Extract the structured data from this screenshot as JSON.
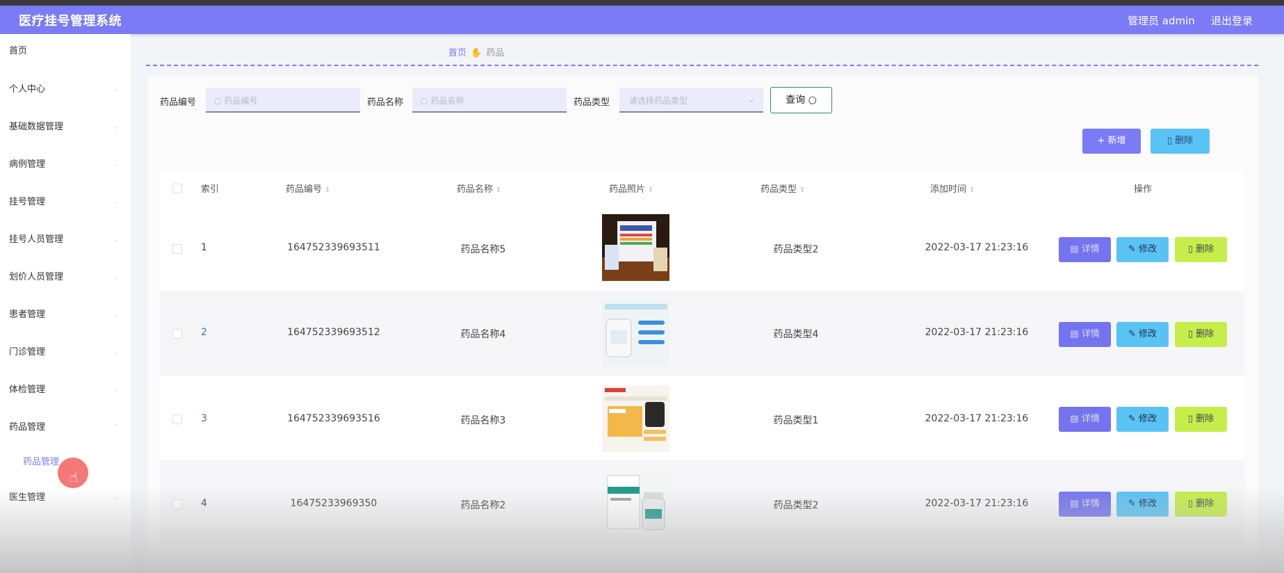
{
  "header": {
    "title": "医疗挂号管理系统",
    "user": "管理员 admin",
    "logout": "退出登录"
  },
  "sidebar": {
    "items": [
      {
        "label": "首页"
      },
      {
        "label": "个人中心"
      },
      {
        "label": "基础数据管理"
      },
      {
        "label": "病例管理"
      },
      {
        "label": "挂号管理"
      },
      {
        "label": "挂号人员管理"
      },
      {
        "label": "划价人员管理"
      },
      {
        "label": "患者管理"
      },
      {
        "label": "门诊管理"
      },
      {
        "label": "体检管理"
      },
      {
        "label": "药品管理"
      },
      {
        "label": "医生管理"
      }
    ],
    "active_sub": "药品管理"
  },
  "breadcrumb": {
    "home": "首页",
    "current": "药品"
  },
  "filters": {
    "code_label": "药品编号",
    "code_placeholder": "药品编号",
    "name_label": "药品名称",
    "name_placeholder": "药品名称",
    "type_label": "药品类型",
    "type_placeholder": "请选择药品类型",
    "search_label": "查询"
  },
  "actions": {
    "add_label": "+ 新增",
    "delete_label": "删除"
  },
  "table": {
    "columns": [
      "索引",
      "药品编号",
      "药品名称",
      "药品照片",
      "药品类型",
      "添加时间",
      "操作"
    ],
    "rows": [
      {
        "index": "1",
        "code": "164752339693511",
        "name": "药品名称5",
        "type": "药品类型2",
        "time": "2022-03-17 21:23:16"
      },
      {
        "index": "2",
        "code": "164752339693512",
        "name": "药品名称4",
        "type": "药品类型4",
        "time": "2022-03-17 21:23:16"
      },
      {
        "index": "3",
        "code": "164752339693516",
        "name": "药品名称3",
        "type": "药品类型1",
        "time": "2022-03-17 21:23:16"
      },
      {
        "index": "4",
        "code": "16475233969350",
        "name": "药品名称2",
        "type": "药品类型2",
        "time": "2022-03-17 21:23:16"
      }
    ],
    "row_actions": {
      "detail": "详情",
      "edit": "修改",
      "delete": "删除"
    }
  },
  "colors": {
    "accent": "#7b7bf7",
    "info": "#5ac3f5",
    "danger_action": "#c5ee4a"
  }
}
